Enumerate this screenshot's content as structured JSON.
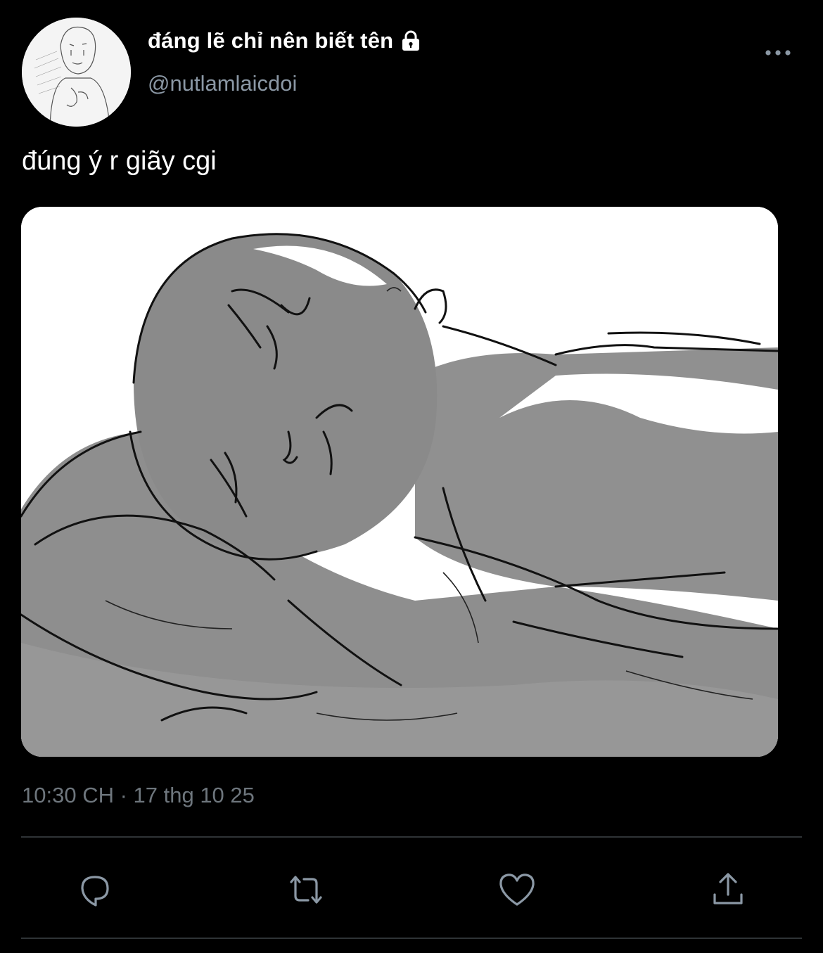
{
  "tweet": {
    "display_name": "đáng lẽ chỉ nên biết tên",
    "handle": "@nutlamlaicdoi",
    "text": "đúng ý r giãy cgi",
    "timestamp": "10:30 CH · 17 thg 10 25",
    "protected": true
  },
  "icons": {
    "lock": "lock-icon",
    "more": "more-horizontal-icon",
    "reply": "reply-bubble-icon",
    "retweet": "retweet-icon",
    "like": "heart-icon",
    "share": "share-upload-icon"
  },
  "colors": {
    "background": "#000000",
    "text_primary": "#ffffff",
    "text_secondary": "#8b98a5",
    "icon_gray": "#8b98a5",
    "divider": "#2f3336"
  }
}
